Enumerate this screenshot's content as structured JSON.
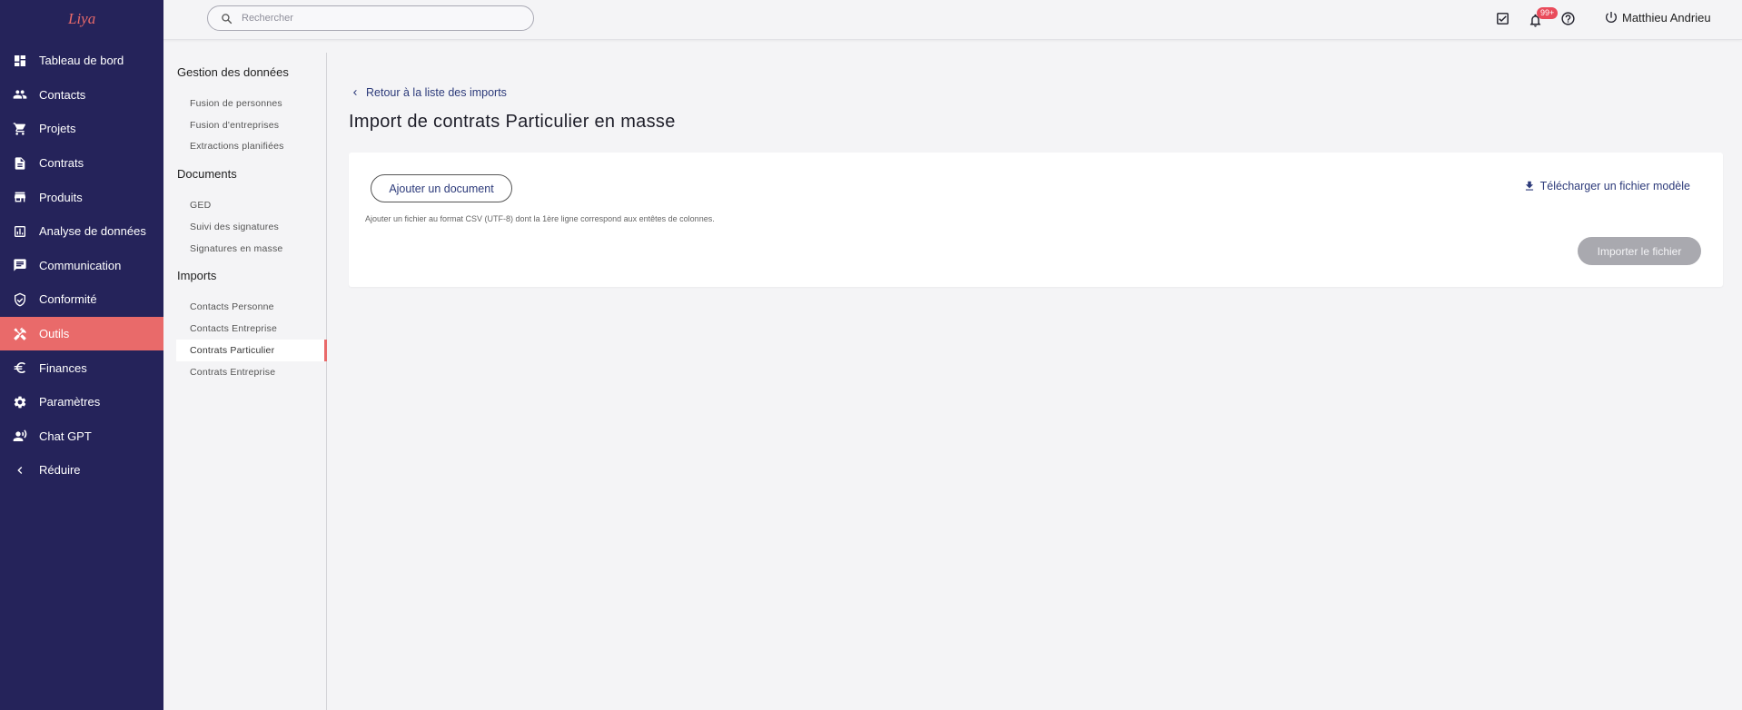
{
  "app": {
    "logo_text": "Liya"
  },
  "sidebar": {
    "items": [
      {
        "label": "Tableau de bord",
        "icon": "dashboard-icon"
      },
      {
        "label": "Contacts",
        "icon": "people-icon"
      },
      {
        "label": "Projets",
        "icon": "cart-icon"
      },
      {
        "label": "Contrats",
        "icon": "document-icon"
      },
      {
        "label": "Produits",
        "icon": "store-icon"
      },
      {
        "label": "Analyse de données",
        "icon": "analytics-icon"
      },
      {
        "label": "Communication",
        "icon": "message-icon"
      },
      {
        "label": "Conformité",
        "icon": "shield-check-icon"
      },
      {
        "label": "Outils",
        "icon": "tools-icon",
        "active": true
      },
      {
        "label": "Finances",
        "icon": "euro-icon"
      },
      {
        "label": "Paramètres",
        "icon": "gear-icon"
      },
      {
        "label": "Chat GPT",
        "icon": "chat-gpt-icon"
      },
      {
        "label": "Réduire",
        "icon": "chevron-left-icon"
      }
    ],
    "colors": {
      "background": "#25235a",
      "active": "#e96a6a"
    }
  },
  "search": {
    "placeholder": "Rechercher",
    "value": ""
  },
  "topbar": {
    "notification_badge": "99+",
    "user_name": "Matthieu Andrieu"
  },
  "subnav": {
    "sections": [
      {
        "title": "Gestion des données",
        "items": [
          "Fusion de personnes",
          "Fusion d'entreprises",
          "Extractions planifiées"
        ]
      },
      {
        "title": "Documents",
        "items": [
          "GED",
          "Suivi des signatures",
          "Signatures en masse"
        ]
      },
      {
        "title": "Imports",
        "items": [
          "Contacts Personne",
          "Contacts Entreprise",
          "Contrats Particulier",
          "Contrats Entreprise"
        ]
      }
    ],
    "active_item": "Contrats Particulier"
  },
  "main": {
    "back_link": "Retour à la liste des imports",
    "title": "Import de contrats Particulier en masse",
    "add_document_label": "Ajouter un document",
    "download_template_label": "Télécharger un fichier modèle",
    "help_text": "Ajouter un fichier au format CSV (UTF-8) dont la 1ère ligne correspond aux entêtes de colonnes.",
    "import_button_label": "Importer le fichier"
  }
}
